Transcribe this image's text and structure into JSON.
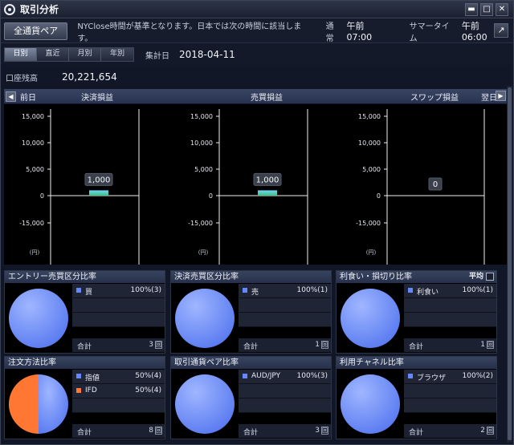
{
  "window": {
    "title": "取引分析"
  },
  "toolbar": {
    "pair_button": "全通貨ペア",
    "note": "NYClose時間が基準となります。日本では次の時間に該当します。",
    "regular_label": "通常",
    "regular_value": "午前　07:00",
    "summer_label": "サマータイム",
    "summer_value": "午前　06:00"
  },
  "period": {
    "tabs": [
      "日別",
      "直近",
      "月別",
      "年別"
    ],
    "active": "日別",
    "agg_label": "集計日",
    "agg_date": "2018-04-11"
  },
  "balance": {
    "label": "口座残高",
    "value": "20,221,654"
  },
  "chart_header": {
    "prev": "前日",
    "next": "翌日",
    "columns": [
      "決済損益",
      "売買損益",
      "スワップ損益"
    ]
  },
  "chart_data": [
    {
      "type": "bar",
      "title": "決済損益",
      "yticks": [
        "15,000",
        "10,000",
        "5,000",
        "0",
        "-15,000"
      ],
      "unit": "(円)",
      "values": [
        1000
      ],
      "data_label": "1,000",
      "ylim": [
        -15000,
        15000
      ]
    },
    {
      "type": "bar",
      "title": "売買損益",
      "yticks": [
        "15,000",
        "10,000",
        "5,000",
        "0",
        "-15,000"
      ],
      "unit": "(円)",
      "values": [
        1000
      ],
      "data_label": "1,000",
      "ylim": [
        -15000,
        15000
      ]
    },
    {
      "type": "bar",
      "title": "スワップ損益",
      "yticks": [
        "15,000",
        "10,000",
        "5,000",
        "0",
        "-15,000"
      ],
      "unit": "(円)",
      "values": [
        0
      ],
      "data_label": "0",
      "ylim": [
        -15000,
        15000
      ]
    }
  ],
  "panels": [
    {
      "title": "エントリー売買区分比率",
      "rows": [
        {
          "label": "買",
          "value": "100%(3)",
          "color": "#6688ff"
        }
      ],
      "total_label": "合計",
      "total_value": "3",
      "unit": "回"
    },
    {
      "title": "決済売買区分比率",
      "rows": [
        {
          "label": "売",
          "value": "100%(1)",
          "color": "#6688ff"
        }
      ],
      "total_label": "合計",
      "total_value": "1",
      "unit": "回"
    },
    {
      "title": "利食い・損切り比率",
      "avg_label": "平均",
      "rows": [
        {
          "label": "利食い",
          "value": "100%(1)",
          "color": "#6688ff"
        }
      ],
      "total_label": "合計",
      "total_value": "1",
      "unit": "回"
    },
    {
      "title": "注文方法比率",
      "rows": [
        {
          "label": "指値",
          "value": "50%(4)",
          "color": "#6688ff"
        },
        {
          "label": "IFD",
          "value": "50%(4)",
          "color": "#ff7733"
        }
      ],
      "total_label": "合計",
      "total_value": "8",
      "unit": "回"
    },
    {
      "title": "取引通貨ペア比率",
      "rows": [
        {
          "label": "AUD/JPY",
          "value": "100%(3)",
          "color": "#6688ff"
        }
      ],
      "total_label": "合計",
      "total_value": "3",
      "unit": "回"
    },
    {
      "title": "利用チャネル比率",
      "rows": [
        {
          "label": "ブラウザ",
          "value": "100%(2)",
          "color": "#6688ff"
        }
      ],
      "total_label": "合計",
      "total_value": "2",
      "unit": "回"
    }
  ]
}
